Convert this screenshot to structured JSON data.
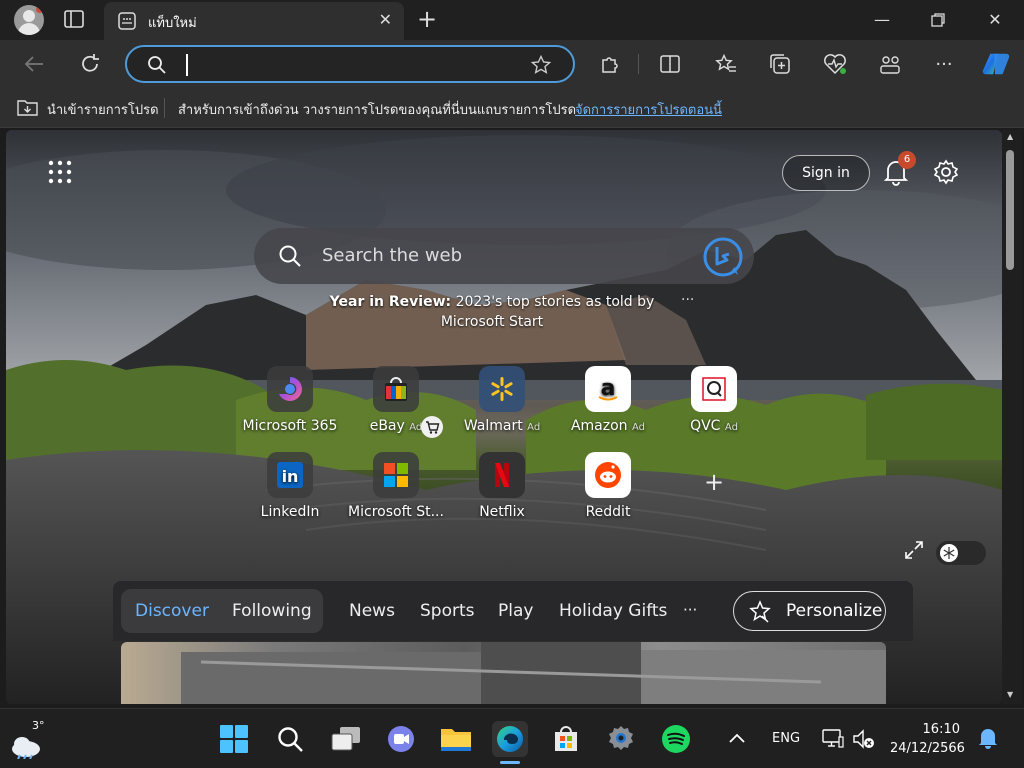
{
  "tab": {
    "title": "แท็บใหม่"
  },
  "address": {
    "value": ""
  },
  "favorites_bar": {
    "import_label": "นำเข้ารายการโปรด",
    "hint": "สำหรับการเข้าถึงด่วน วางรายการโปรดของคุณที่นี่บนแถบรายการโปรด",
    "manage_link": "จัดการรายการโปรดตอนนี้"
  },
  "newtab": {
    "sign_in": "Sign in",
    "notification_count": "6",
    "search_placeholder": "Search the web",
    "year_in_review_bold": "Year in Review:",
    "year_in_review_text": "2023's top stories as told by Microsoft Start",
    "more_glyph": "···",
    "ad_label": "Ad",
    "quick_links": [
      {
        "label": "Microsoft 365",
        "ad": false
      },
      {
        "label": "eBay",
        "ad": true
      },
      {
        "label": "Walmart",
        "ad": true
      },
      {
        "label": "Amazon",
        "ad": true
      },
      {
        "label": "QVC",
        "ad": true
      },
      {
        "label": "LinkedIn",
        "ad": false
      },
      {
        "label": "Microsoft St...",
        "ad": false
      },
      {
        "label": "Netflix",
        "ad": false
      },
      {
        "label": "Reddit",
        "ad": false
      }
    ],
    "add_tile": "+"
  },
  "discover_nav": {
    "tabs": [
      "Discover",
      "Following",
      "News",
      "Sports",
      "Play",
      "Holiday Gifts"
    ],
    "more": "···",
    "personalize": "Personalize"
  },
  "taskbar": {
    "weather_temp": "3°",
    "language": "ENG",
    "time": "16:10",
    "date": "24/12/2566"
  },
  "colors": {
    "accent": "#4f9bd9",
    "discover_active": "#6cb6ff",
    "notification_badge": "#c84a2c"
  }
}
